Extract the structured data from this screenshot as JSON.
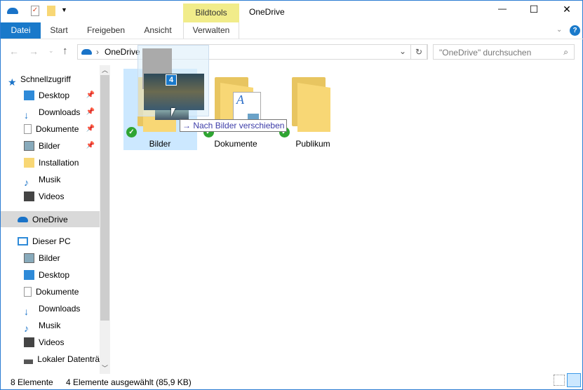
{
  "title": "OneDrive",
  "context_tab": "Bildtools",
  "tabs": [
    "Datei",
    "Start",
    "Freigeben",
    "Ansicht",
    "Verwalten"
  ],
  "address": {
    "location": "OneDrive",
    "search_placeholder": "\"OneDrive\" durchsuchen"
  },
  "nav": {
    "quick_access": "Schnellzugriff",
    "quick_items": [
      "Desktop",
      "Downloads",
      "Dokumente",
      "Bilder",
      "Installation",
      "Musik",
      "Videos"
    ],
    "onedrive": "OneDrive",
    "this_pc": "Dieser PC",
    "pc_items": [
      "Bilder",
      "Desktop",
      "Dokumente",
      "Downloads",
      "Musik",
      "Videos",
      "Lokaler Datenträ"
    ]
  },
  "folders": [
    "Bilder",
    "Dokumente",
    "Publikum"
  ],
  "drag": {
    "count": "4",
    "tooltip": "Nach Bilder verschieben",
    "arrow": "→"
  },
  "status": {
    "count": "8 Elemente",
    "selected": "4 Elemente ausgewählt (85,9 KB)"
  },
  "window_controls": {
    "min": "—",
    "max": "☐",
    "close": "✕"
  },
  "help": "?"
}
